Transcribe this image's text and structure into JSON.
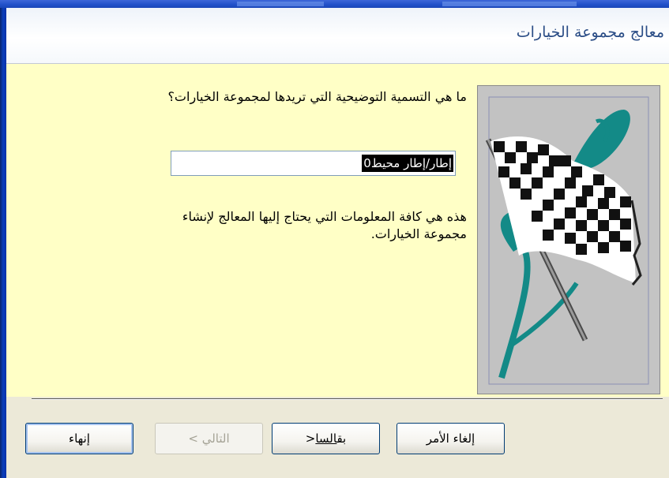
{
  "wizard": {
    "title": "معالج مجموعة الخيارات",
    "question": "ما هي التسمية التوضيحية التي تريدها لمجموعة الخيارات؟",
    "caption_value": "إطار/إطار محيط0",
    "info_line1": "هذه هي كافة المعلومات التي يحتاج إليها المعالج لإنشاء",
    "info_line2": "مجموعة الخيارات.",
    "image_icon": "checkered-flag-icon"
  },
  "buttons": {
    "cancel": "إلغاء الأمر",
    "back_prefix": "< ",
    "back_mnemonic": "السا",
    "back_rest": "بق",
    "next": "التالي >",
    "finish": "إنهاء"
  },
  "colors": {
    "content_bg": "#ffffc6",
    "title_text": "#2b4d86",
    "flag_teal": "#138a87"
  }
}
